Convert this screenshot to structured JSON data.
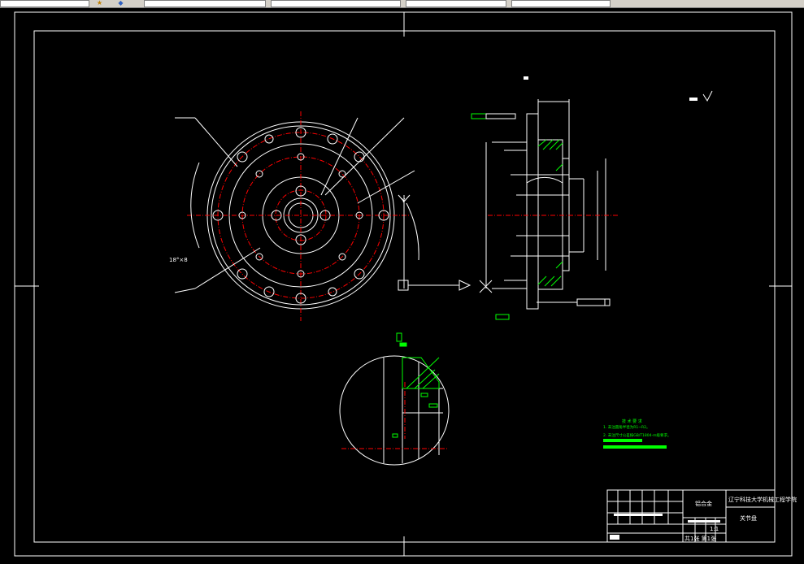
{
  "toolbar": {
    "icons": [
      "folder-icon",
      "shield-icon"
    ],
    "dropdowns": [
      "",
      "",
      "",
      "",
      ""
    ]
  },
  "colors": {
    "background": "#000000",
    "lines": "#ffffff",
    "center_lines": "#ff0000",
    "dimension": "#00ff00",
    "toolbar": "#d4d0c8"
  },
  "drawing": {
    "front_view_labels": {
      "angle_note": "18°×8",
      "y_axis": "Y"
    },
    "title_block": {
      "material": "铝合金",
      "school": "辽宁科技大学机械工程学院",
      "part_name": "关节盘",
      "scale": "1:1",
      "sheet": "共1张 第1张"
    },
    "tech_requirements": {
      "heading": "技 术 要 求",
      "line1": "1. 未注圆角半径为R1~R2。",
      "line2": "2. 未注尺寸公差按GB/T1804-m级要求。"
    }
  }
}
